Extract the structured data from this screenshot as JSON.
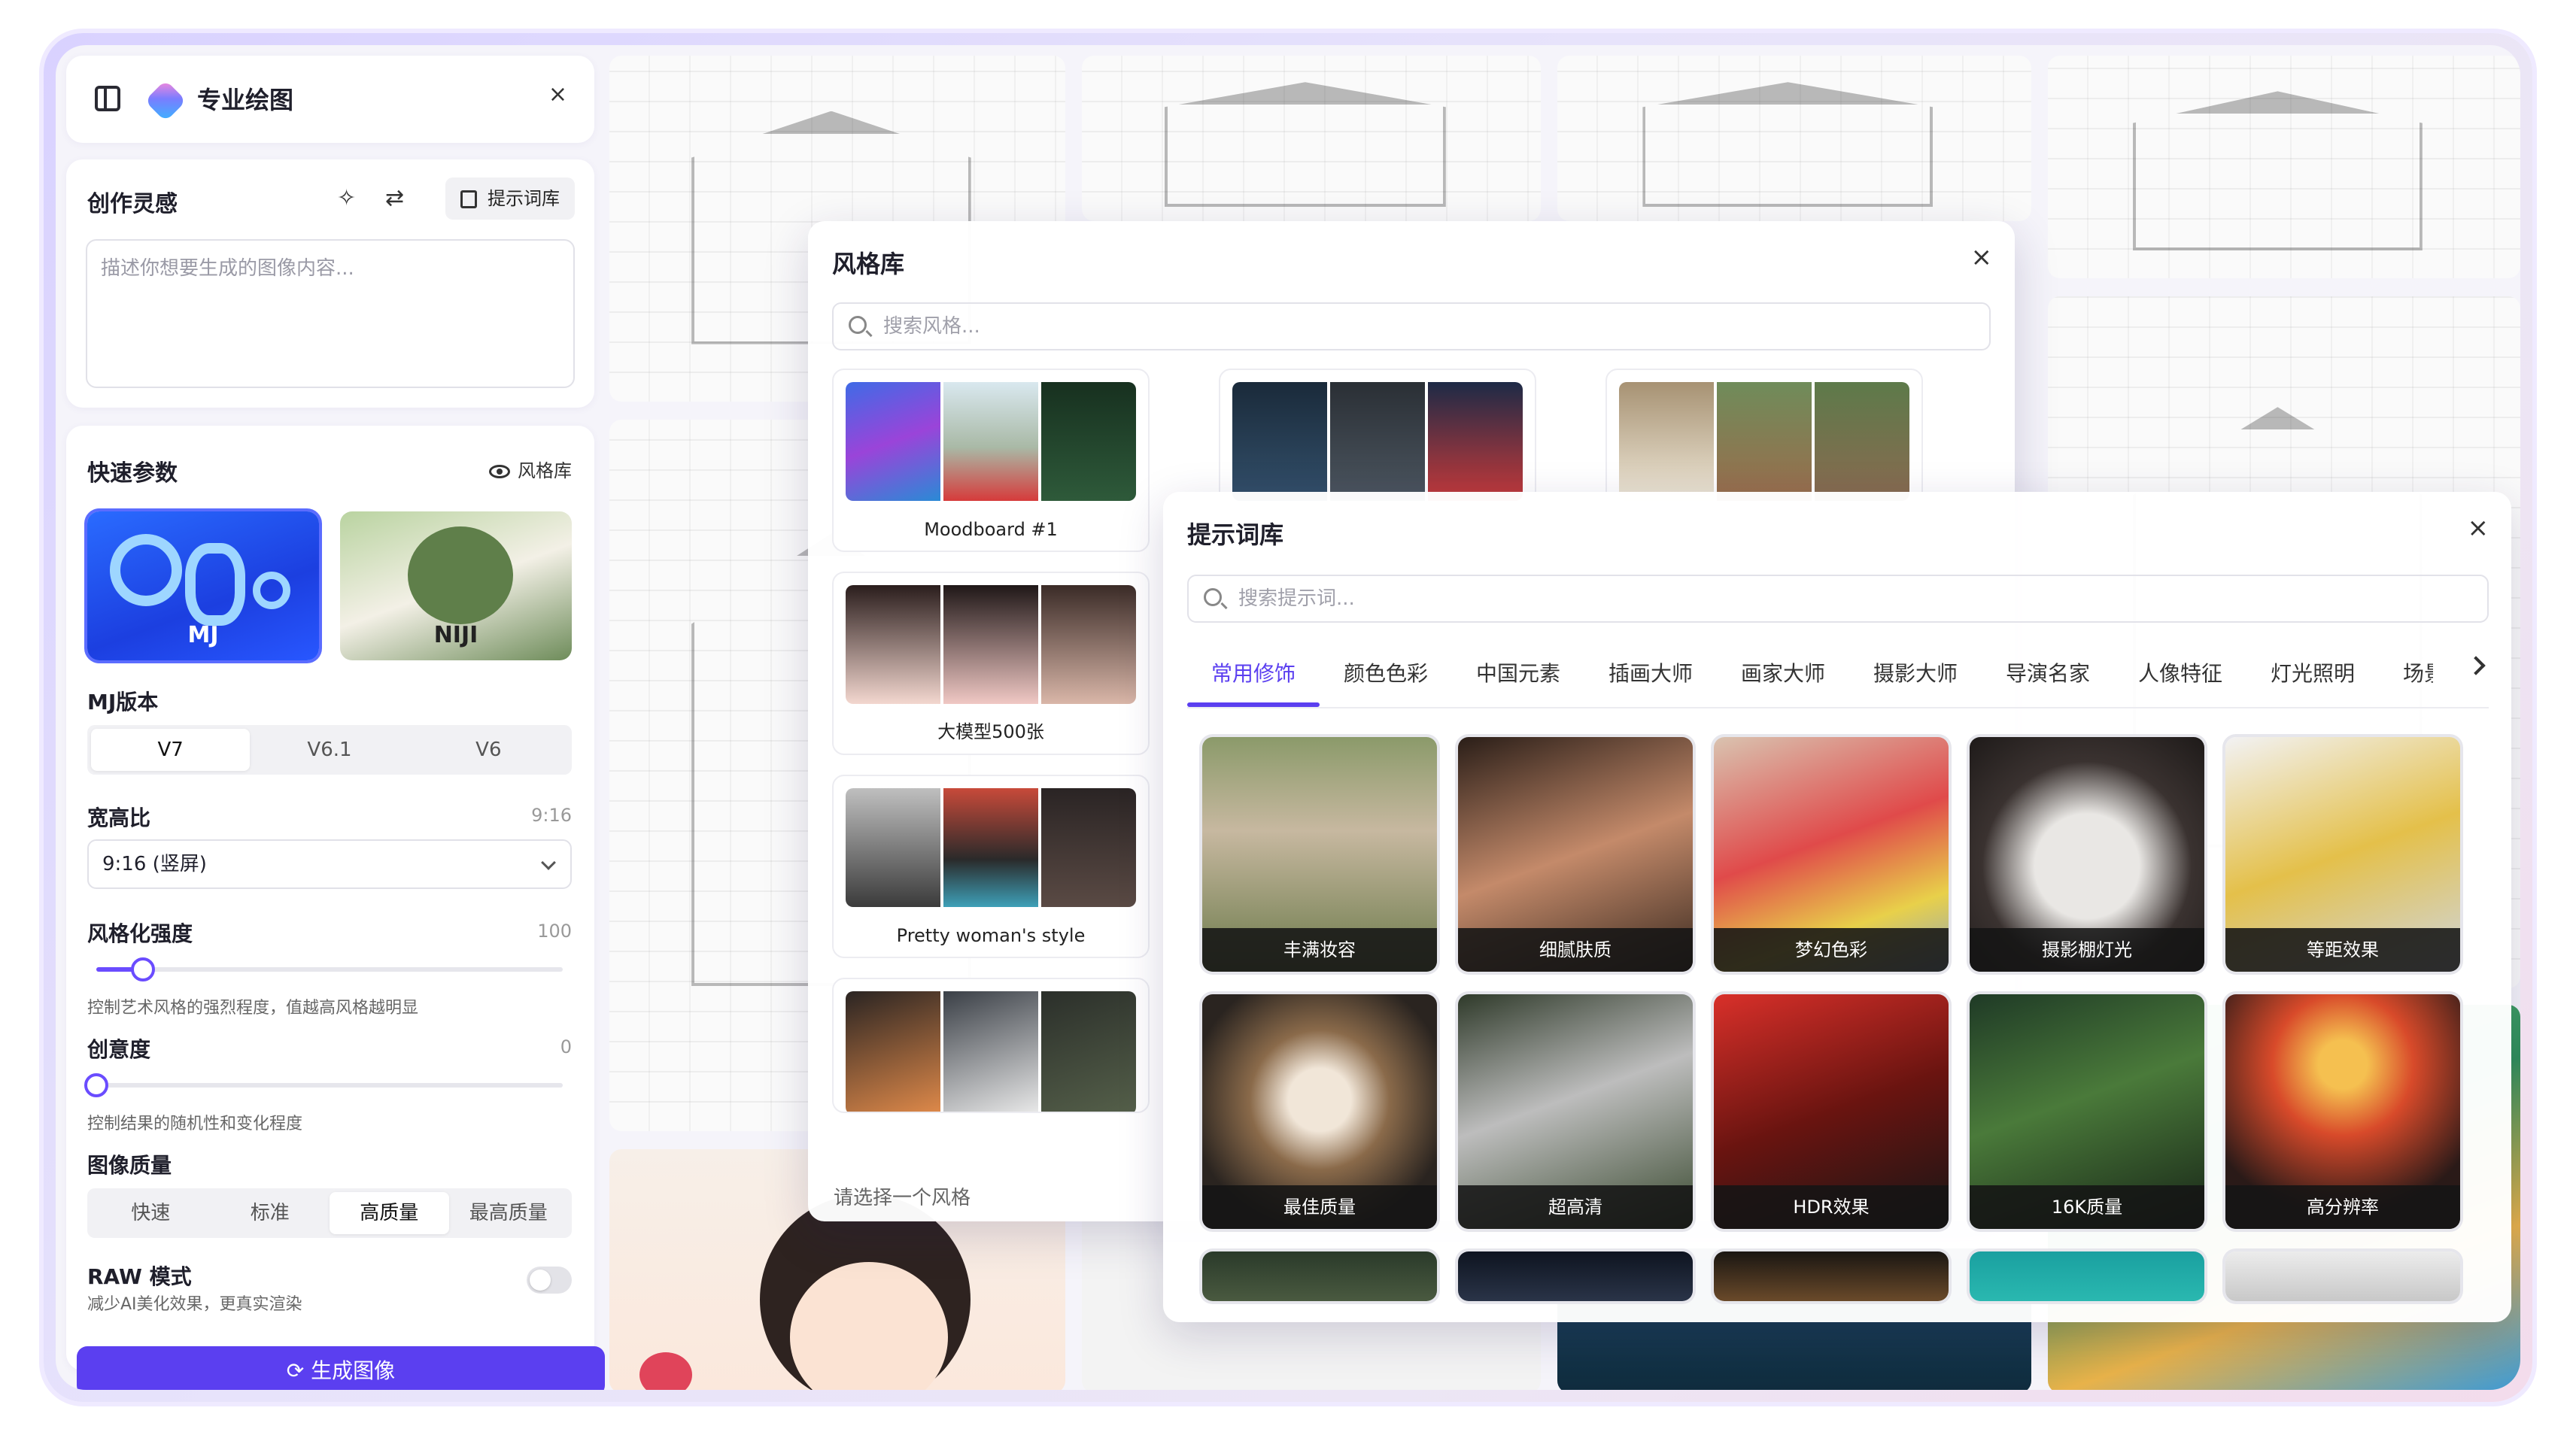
{
  "app": {
    "title": "专业绘图"
  },
  "inspiration": {
    "heading": "创作灵感",
    "prompt_lib_btn": "提示词库",
    "placeholder": "描述你想要生成的图像内容..."
  },
  "quick": {
    "heading": "快速参数",
    "style_lib_link": "风格库",
    "modes": [
      {
        "label": "MJ"
      },
      {
        "label": "NIJI"
      }
    ],
    "version": {
      "label": "MJ版本",
      "options": [
        "V7",
        "V6.1",
        "V6"
      ],
      "selected": "V7"
    },
    "aspect": {
      "label": "宽高比",
      "value": "9:16",
      "selected": "9:16 (竖屏)"
    },
    "stylize": {
      "label": "风格化强度",
      "value": "100",
      "level": 0.1,
      "hint": "控制艺术风格的强烈程度，值越高风格越明显"
    },
    "chaos": {
      "label": "创意度",
      "value": "0",
      "level": 0.0,
      "hint": "控制结果的随机性和变化程度"
    },
    "quality": {
      "label": "图像质量",
      "options": [
        "快速",
        "标准",
        "高质量",
        "最高质量"
      ],
      "selected": "高质量"
    },
    "raw": {
      "label": "RAW 模式",
      "hint": "减少AI美化效果，更真实渲染",
      "on": false
    },
    "generate_label": "生成图像"
  },
  "style_modal": {
    "title": "风格库",
    "search_placeholder": "搜索风格...",
    "items": [
      {
        "caption": "Moodboard #1"
      },
      {
        "caption": ""
      },
      {
        "caption": ""
      },
      {
        "caption": "大模型500张"
      },
      {
        "caption": "Pretty woman's style"
      },
      {
        "caption": ""
      }
    ],
    "footer": "请选择一个风格"
  },
  "prompt_modal": {
    "title": "提示词库",
    "search_placeholder": "搜索提示词...",
    "tabs": [
      "常用修饰",
      "颜色色彩",
      "中国元素",
      "插画大师",
      "画家大师",
      "摄影大师",
      "导演名家",
      "人像特征",
      "灯光照明",
      "场景"
    ],
    "active_tab": "常用修饰",
    "tiles": [
      "丰满妆容",
      "细腻肤质",
      "梦幻色彩",
      "摄影棚灯光",
      "等距效果",
      "最佳质量",
      "超高清",
      "HDR效果",
      "16K质量",
      "高分辨率"
    ]
  },
  "colors": {
    "accent": "#5b3ff0",
    "mj_card": "#1c3fe0"
  }
}
